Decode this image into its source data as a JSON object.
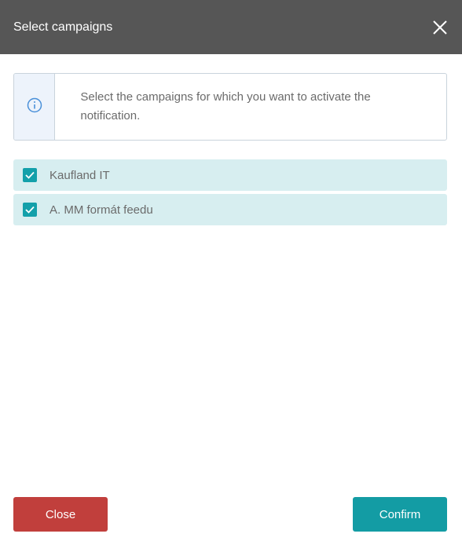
{
  "header": {
    "title": "Select campaigns"
  },
  "info": {
    "text": "Select the campaigns for which you want to activate the notification."
  },
  "campaigns": [
    {
      "label": "Kaufland IT",
      "checked": true
    },
    {
      "label": "A. MM formát feedu",
      "checked": true
    }
  ],
  "footer": {
    "close_label": "Close",
    "confirm_label": "Confirm"
  },
  "colors": {
    "header_bg": "#565656",
    "accent": "#13a0aa",
    "danger": "#c13f3c",
    "row_bg": "#d7eef0",
    "info_icon": "#4a90d9"
  },
  "icons": {
    "close": "close-icon",
    "info": "info-icon",
    "check": "checkmark-icon"
  }
}
